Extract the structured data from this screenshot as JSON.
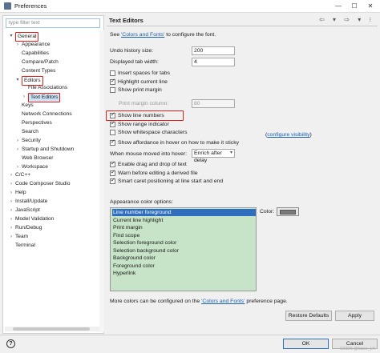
{
  "window": {
    "title": "Preferences",
    "minimize": "—",
    "maximize": "☐",
    "close": "✕"
  },
  "filter": {
    "placeholder": "type filter text"
  },
  "tree": [
    {
      "label": "General",
      "arrow": "▾",
      "level": 0,
      "boxed": true
    },
    {
      "label": "Appearance",
      "arrow": "›",
      "level": 1
    },
    {
      "label": "Capabilities",
      "arrow": "",
      "level": 1
    },
    {
      "label": "Compare/Patch",
      "arrow": "",
      "level": 1
    },
    {
      "label": "Content Types",
      "arrow": "",
      "level": 1
    },
    {
      "label": "Editors",
      "arrow": "▾",
      "level": 1,
      "boxed": true
    },
    {
      "label": "File Associations",
      "arrow": "",
      "level": 2
    },
    {
      "label": "Text Editors",
      "arrow": "›",
      "level": 2,
      "boxed": true,
      "selected": true
    },
    {
      "label": "Keys",
      "arrow": "",
      "level": 1
    },
    {
      "label": "Network Connections",
      "arrow": "",
      "level": 1
    },
    {
      "label": "Perspectives",
      "arrow": "",
      "level": 1
    },
    {
      "label": "Search",
      "arrow": "",
      "level": 1
    },
    {
      "label": "Security",
      "arrow": "›",
      "level": 1
    },
    {
      "label": "Startup and Shutdown",
      "arrow": "›",
      "level": 1
    },
    {
      "label": "Web Browser",
      "arrow": "",
      "level": 1
    },
    {
      "label": "Workspace",
      "arrow": "›",
      "level": 1
    },
    {
      "label": "C/C++",
      "arrow": "›",
      "level": 0
    },
    {
      "label": "Code Composer Studio",
      "arrow": "›",
      "level": 0
    },
    {
      "label": "Help",
      "arrow": "›",
      "level": 0
    },
    {
      "label": "Install/Update",
      "arrow": "›",
      "level": 0
    },
    {
      "label": "JavaScript",
      "arrow": "›",
      "level": 0
    },
    {
      "label": "Model Validation",
      "arrow": "›",
      "level": 0
    },
    {
      "label": "Run/Debug",
      "arrow": "›",
      "level": 0
    },
    {
      "label": "Team",
      "arrow": "›",
      "level": 0
    },
    {
      "label": "Terminal",
      "arrow": "",
      "level": 0
    }
  ],
  "page": {
    "title": "Text Editors",
    "nav": "⇦ ▾ ⇨ ▾ ⁝",
    "intro_prefix": "See ",
    "intro_link": "'Colors and Fonts'",
    "intro_suffix": " to configure the font.",
    "undo_label": "Undo history size:",
    "undo_value": "200",
    "tab_label": "Displayed tab width:",
    "tab_value": "4",
    "checkboxes": [
      {
        "label": "Insert spaces for tabs",
        "checked": false
      },
      {
        "label": "Highlight current line",
        "checked": true
      },
      {
        "label": "Show print margin",
        "checked": false
      }
    ],
    "print_margin_label": "Print margin column:",
    "print_margin_value": "80",
    "checkboxes2": [
      {
        "label": "Show line numbers",
        "checked": true
      },
      {
        "label": "Show range indicator",
        "checked": true
      },
      {
        "label": "Show whitespace characters",
        "checked": false
      }
    ],
    "whitespace_link": "configure visibility",
    "whitespace_open": "(",
    "whitespace_close": ")",
    "affordance": {
      "label": "Show affordance in hover on how to make it sticky",
      "checked": true
    },
    "hover_label": "When mouse moved into hover:",
    "hover_value": "Enrich after delay",
    "checkboxes3": [
      {
        "label": "Enable drag and drop of text",
        "checked": true
      },
      {
        "label": "Warn before editing a derived file",
        "checked": true
      },
      {
        "label": "Smart caret positioning at line start and end",
        "checked": true
      }
    ],
    "appearance_label": "Appearance color options:",
    "color_items": [
      "Line number foreground",
      "Current line highlight",
      "Print margin",
      "Find scope",
      "Selection foreground color",
      "Selection background color",
      "Background color",
      "Foreground color",
      "Hyperlink"
    ],
    "color_label": "Color:",
    "footer_prefix": "More colors can be configured on the ",
    "footer_link": "'Colors and Fonts'",
    "footer_suffix": " preference page.",
    "restore_label": "Restore Defaults",
    "apply_label": "Apply"
  },
  "bottom": {
    "help": "?",
    "ok_label": "OK",
    "cancel_label": "Cancel",
    "watermark": "CSDN @kane_LY"
  }
}
